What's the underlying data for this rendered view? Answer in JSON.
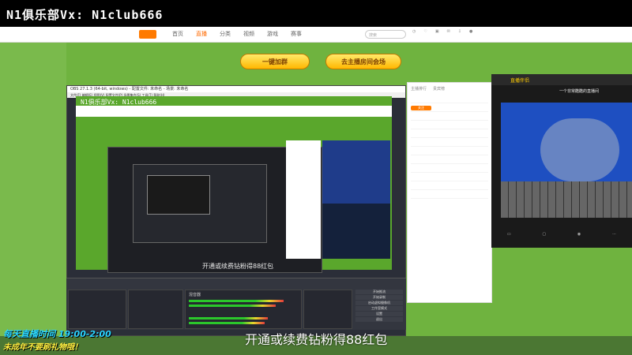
{
  "watermark": "N1俱乐部Vx: N1club666",
  "watermark_inner": "N1俱乐部Vx: N1club666",
  "site": {
    "nav": [
      "首页",
      "直播",
      "分类",
      "视频",
      "游戏",
      "赛事"
    ],
    "search_placeholder": "搜索"
  },
  "banner": {
    "join_group": "一键加群",
    "go_room": "去主播房间会场"
  },
  "obs": {
    "title": "OBS 27.1.3 (64-bit, windows) - 配置文件: 未命名 - 场景: 未命名",
    "menu": "文件(F)  编辑(E)  视图(V)  配置文件(P)  场景集合(S)  工具(T)  帮助(H)",
    "mixer_label": "混音器",
    "controls": [
      "开始推流",
      "开始录制",
      "启动虚拟摄像机",
      "工作室模式",
      "设置",
      "退出"
    ]
  },
  "chat": {
    "tabs": [
      "主播排行",
      "贵宾榜"
    ],
    "follow": "关注"
  },
  "right_panel": {
    "brand": "直播伴侣",
    "room": "一个非常酷酷的直播间"
  },
  "subtitle": "开通或续费钻粉得88红包",
  "subtitle_inner": "开通或续费钻粉得88红包",
  "bottom_text_1": "每天直播时间 19:00-2:00",
  "bottom_text_2": "未成年不要刷礼物哦！"
}
